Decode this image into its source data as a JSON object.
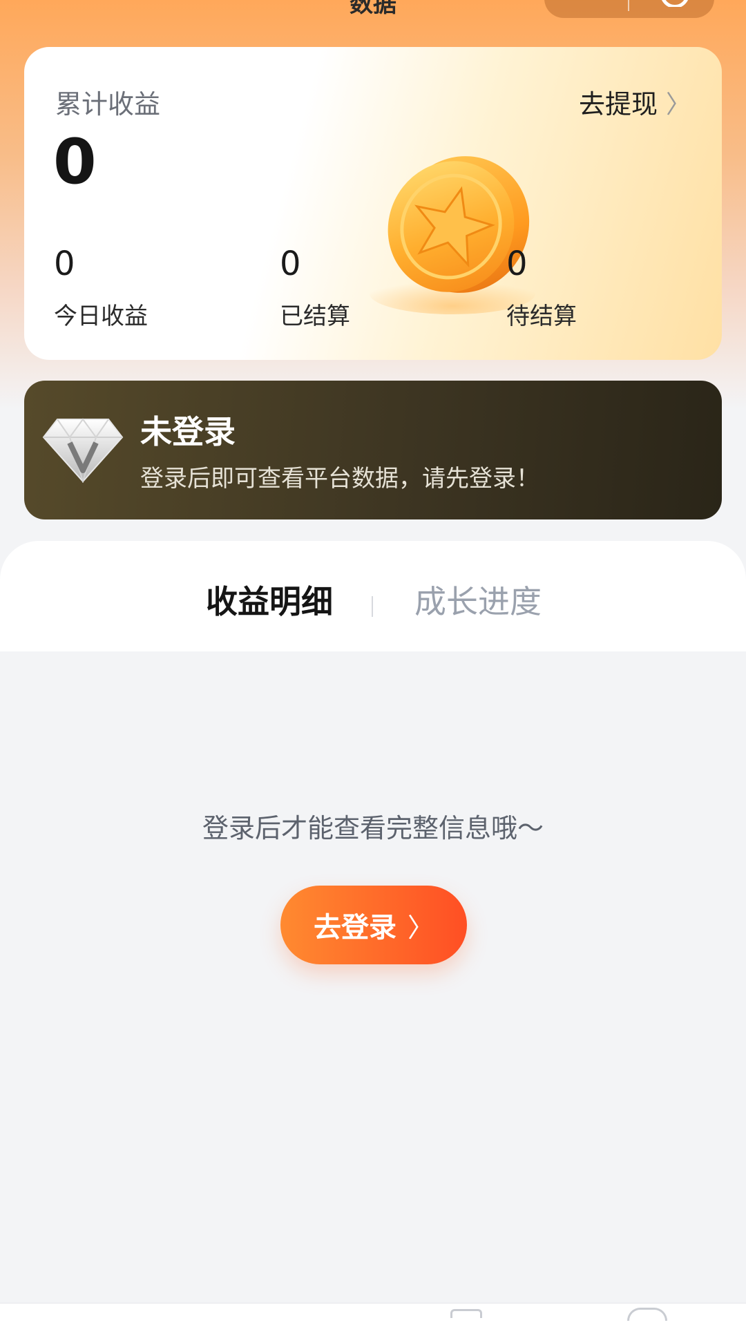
{
  "header": {
    "title": "数据",
    "menu_icon": "more-dots-icon",
    "close_icon": "target-close-icon"
  },
  "earnings": {
    "label": "累计收益",
    "total": "0",
    "withdraw_label": "去提现",
    "withdraw_icon": "chevron-right-icon",
    "stats": [
      {
        "value": "0",
        "label": "今日收益"
      },
      {
        "value": "0",
        "label": "已结算"
      },
      {
        "value": "0",
        "label": "待结算"
      }
    ],
    "coin_icon": "star-coin-icon"
  },
  "login_banner": {
    "icon": "diamond-v-icon",
    "title": "未登录",
    "subtitle": "登录后即可查看平台数据，请先登录！"
  },
  "tabs": [
    {
      "label": "收益明细",
      "active": true
    },
    {
      "label": "成长进度",
      "active": false
    }
  ],
  "empty_state": {
    "message": "登录后才能查看完整信息哦～",
    "button_label": "去登录",
    "button_icon": "chevron-right-icon"
  },
  "colors": {
    "accent": "#ff6a35",
    "banner_dark": "#3d3522",
    "header_orange": "#ffa85a"
  }
}
